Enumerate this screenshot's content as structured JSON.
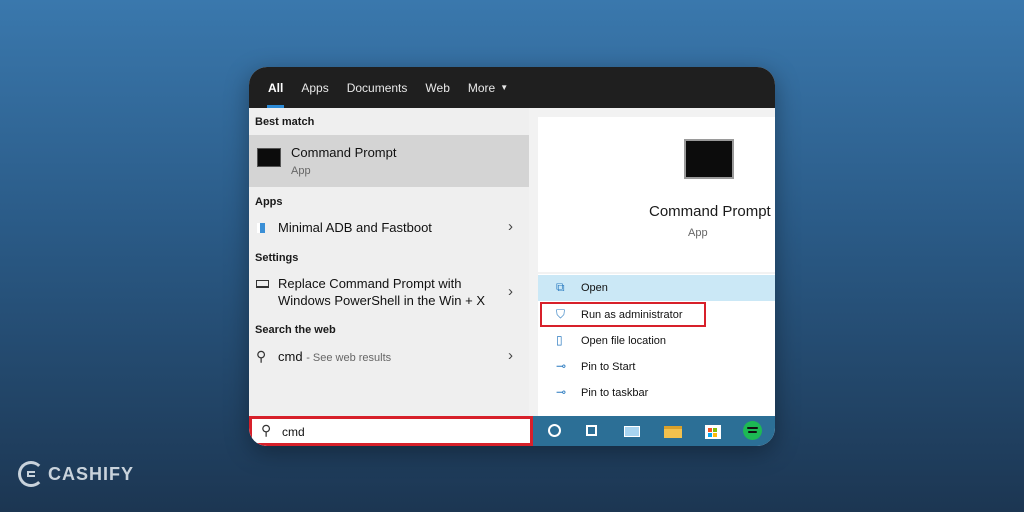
{
  "tabs": [
    {
      "label": "All"
    },
    {
      "label": "Apps"
    },
    {
      "label": "Documents"
    },
    {
      "label": "Web"
    },
    {
      "label": "More"
    }
  ],
  "left": {
    "best_match_title": "Best match",
    "best_match": {
      "name": "Command Prompt",
      "type": "App"
    },
    "apps_title": "Apps",
    "apps_item": "Minimal ADB and Fastboot",
    "settings_title": "Settings",
    "settings_item_line1": "Replace Command Prompt with",
    "settings_item_line2": "Windows PowerShell in the Win + X",
    "web_title": "Search the web",
    "web_query": "cmd",
    "web_suffix": "- See web results"
  },
  "right": {
    "title": "Command Prompt",
    "subtitle": "App",
    "actions": [
      {
        "label": "Open",
        "icon": "open-icon"
      },
      {
        "label": "Run as administrator",
        "icon": "shield-icon"
      },
      {
        "label": "Open file location",
        "icon": "file-icon"
      },
      {
        "label": "Pin to Start",
        "icon": "pin-icon"
      },
      {
        "label": "Pin to taskbar",
        "icon": "pin-icon"
      }
    ]
  },
  "search": {
    "value": "cmd"
  },
  "taskbar_icons": [
    "cortana-icon",
    "task-view-icon",
    "store-app-icon",
    "file-explorer-icon",
    "microsoft-store-icon",
    "spotify-icon"
  ],
  "brand": {
    "name": "CASHIFY"
  },
  "colors": {
    "highlight_red": "#d7202a",
    "accent_blue": "#2b8ad6",
    "taskbar": "#2c6f96"
  }
}
